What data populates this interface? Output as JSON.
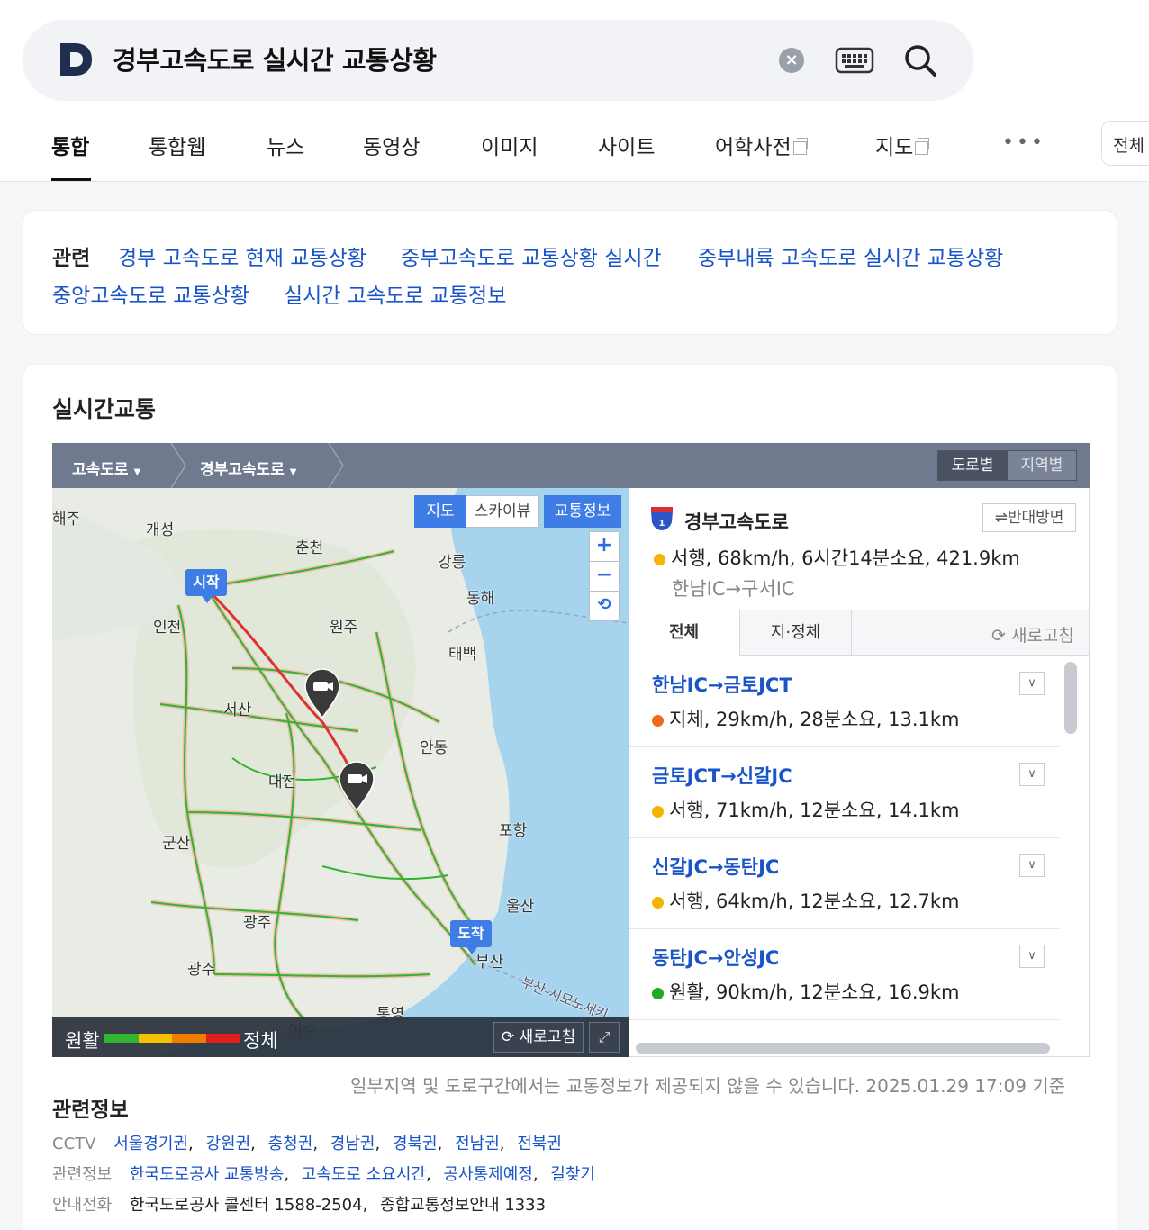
{
  "search": {
    "query": "경부고속도로 실시간 교통상황",
    "clear_symbol": "×"
  },
  "tabs": [
    {
      "label": "통합"
    },
    {
      "label": "통합웹"
    },
    {
      "label": "뉴스"
    },
    {
      "label": "동영상"
    },
    {
      "label": "이미지"
    },
    {
      "label": "사이트"
    },
    {
      "label": "어학사전"
    },
    {
      "label": "지도"
    }
  ],
  "filter_label": "전체",
  "related": {
    "title": "관련",
    "links": [
      "경부 고속도로 현재 교통상황",
      "중부고속도로 교통상황 실시간",
      "중부내륙 고속도로 실시간 교통상황",
      "중앙고속도로 교통상황",
      "실시간 고속도로 교통정보"
    ]
  },
  "traffic": {
    "title": "실시간교통",
    "breadcrumb": [
      "고속도로",
      "경부고속도로"
    ],
    "view_toggle": [
      "도로별",
      "지역별"
    ],
    "map_modes": [
      "지도",
      "스카이뷰",
      "교통정보"
    ],
    "zoom_in": "+",
    "zoom_out": "−",
    "zoom_reset": "⟲",
    "start_label": "시작",
    "end_label": "도착",
    "map_labels": [
      "해주",
      "개성",
      "춘천",
      "강릉",
      "동해",
      "원주",
      "태백",
      "서산",
      "인천",
      "안동",
      "대전",
      "포항",
      "군산",
      "울산",
      "광주",
      "부산",
      "통영",
      "여수",
      "광주",
      "부산-시모노세키"
    ],
    "legend": {
      "smooth": "원활",
      "jam": "정체",
      "colors": [
        "#2fb52f",
        "#f2c200",
        "#f07c00",
        "#e02020"
      ]
    },
    "map_refresh": "새로고침",
    "road": {
      "name": "경부고속도로",
      "shield_number": "1",
      "opposite_label": "⇌반대방면",
      "status": "서행, 68km/h, 6시간14분소요, 421.9km",
      "status_color": "#f5b400",
      "range": "한남IC→구서IC"
    },
    "panel_tabs": {
      "all": "전체",
      "jam": "지·정체",
      "refresh": "새로고침"
    },
    "segments": [
      {
        "name": "한남IC→금토JCT",
        "status": "지체, 29km/h, 28분소요, 13.1km",
        "color": "#f06a1a"
      },
      {
        "name": "금토JCT→신갈JC",
        "status": "서행, 71km/h, 12분소요, 14.1km",
        "color": "#f5b400"
      },
      {
        "name": "신갈JC→동탄JC",
        "status": "서행, 64km/h, 12분소요, 12.7km",
        "color": "#f5b400"
      },
      {
        "name": "동탄JC→안성JC",
        "status": "원활, 90km/h, 12분소요, 16.9km",
        "color": "#22a822"
      }
    ],
    "disclaimer": "일부지역 및 도로구간에서는 교통정보가 제공되지 않을 수 있습니다. 2025.01.29 17:09 기준"
  },
  "related_info": {
    "title": "관련정보",
    "cctv_label": "CCTV",
    "cctv_links": [
      "서울경기권",
      "강원권",
      "충청권",
      "경남권",
      "경북권",
      "전남권",
      "전북권"
    ],
    "info_label": "관련정보",
    "info_links": [
      "한국도로공사 교통방송",
      "고속도로 소요시간",
      "공사통제예정",
      "길찾기"
    ],
    "phone_label": "안내전화",
    "phones": [
      "한국도로공사 콜센터 1588-2504",
      "종합교통정보안내 1333"
    ]
  }
}
